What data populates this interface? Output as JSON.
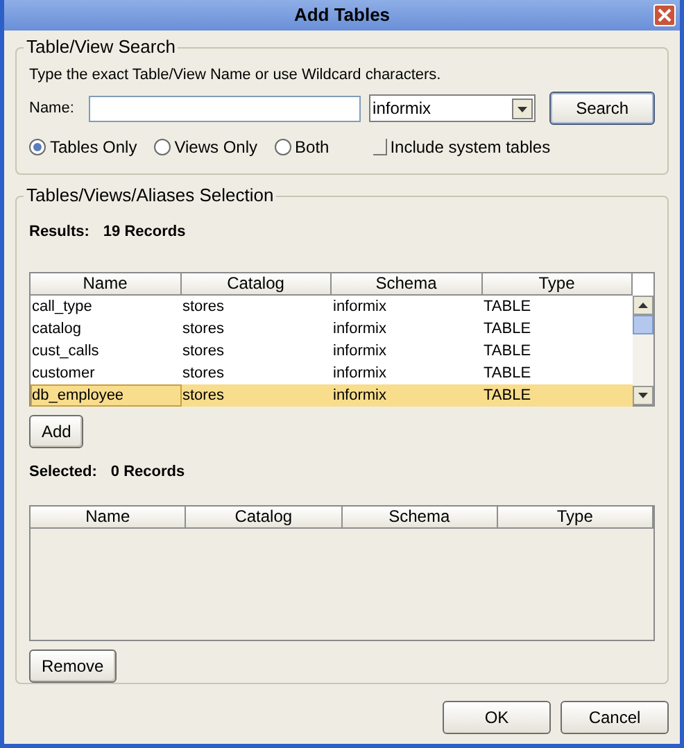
{
  "window": {
    "title": "Add Tables"
  },
  "search_group": {
    "title": "Table/View Search",
    "hint": "Type the exact Table/View Name or use Wildcard characters.",
    "name_label": "Name:",
    "schema_value": "informix",
    "search_button": "Search",
    "options": [
      {
        "label": "Tables Only",
        "selected": true
      },
      {
        "label": "Views Only",
        "selected": false
      },
      {
        "label": "Both",
        "selected": false
      }
    ],
    "system_tables": {
      "label": "Include system tables",
      "checked": false
    }
  },
  "selection_group": {
    "title": "Tables/Views/Aliases Selection",
    "results_label": "Results:",
    "results_count": "19 Records",
    "results_columns": [
      "Name",
      "Catalog",
      "Schema",
      "Type"
    ],
    "results_rows": [
      {
        "cells": [
          "call_type",
          "stores",
          "informix",
          "TABLE"
        ],
        "selected": false
      },
      {
        "cells": [
          "catalog",
          "stores",
          "informix",
          "TABLE"
        ],
        "selected": false
      },
      {
        "cells": [
          "cust_calls",
          "stores",
          "informix",
          "TABLE"
        ],
        "selected": false
      },
      {
        "cells": [
          "customer",
          "stores",
          "informix",
          "TABLE"
        ],
        "selected": false
      },
      {
        "cells": [
          "db_employee",
          "stores",
          "informix",
          "TABLE"
        ],
        "selected": true
      }
    ],
    "add_button": "Add",
    "selected_label": "Selected:",
    "selected_count": "0 Records",
    "selected_columns": [
      "Name",
      "Catalog",
      "Schema",
      "Type"
    ],
    "remove_button": "Remove"
  },
  "buttons": [
    "OK",
    "Cancel"
  ]
}
